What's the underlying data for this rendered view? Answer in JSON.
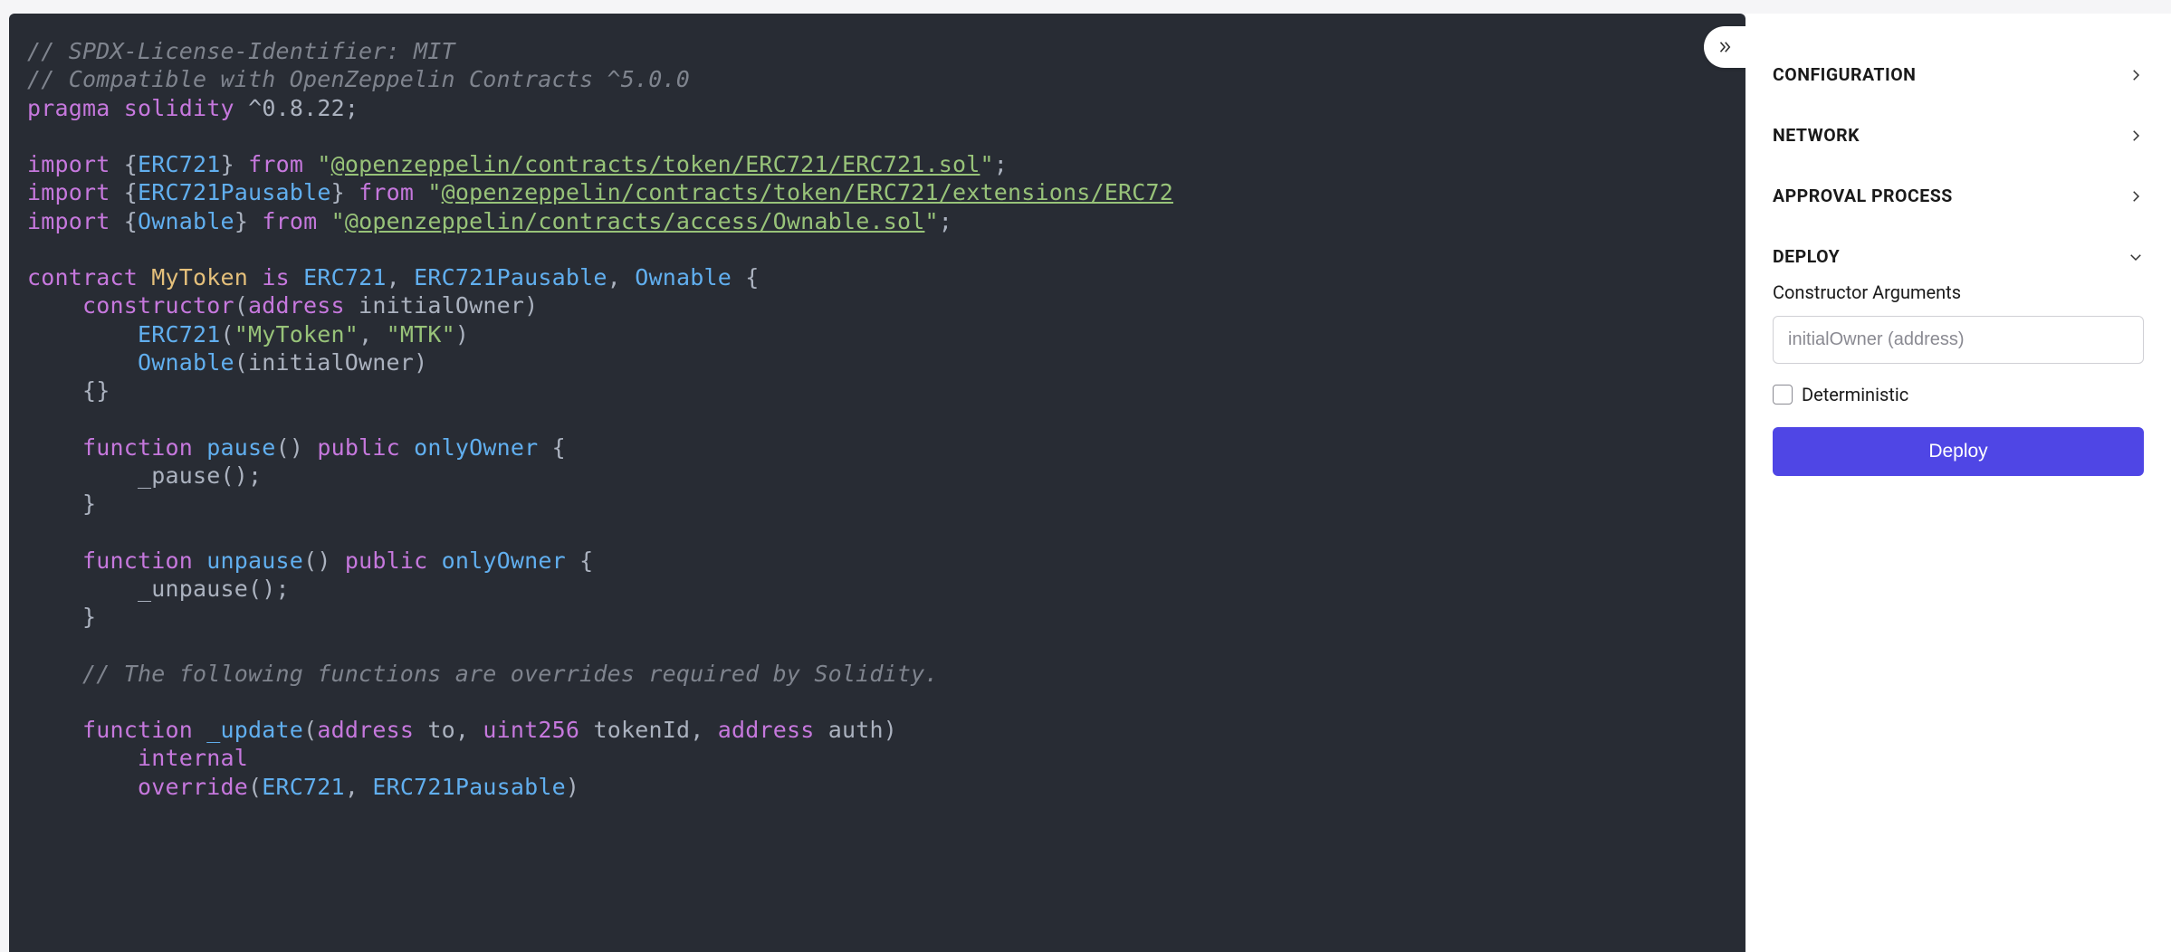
{
  "code": {
    "l1": "// SPDX-License-Identifier: MIT",
    "l2": "// Compatible with OpenZeppelin Contracts ^5.0.0",
    "pragma_kw": "pragma",
    "solidity_kw": "solidity",
    "version": "^0.8.22",
    "import_kw": "import",
    "from_kw": "from",
    "erc721": "ERC721",
    "erc721_link": "@openzeppelin/contracts/token/ERC721/ERC721.sol",
    "erc721pausable": "ERC721Pausable",
    "erc721pausable_link": "@openzeppelin/contracts/token/ERC721/extensions/ERC72",
    "ownable": "Ownable",
    "ownable_link": "@openzeppelin/contracts/access/Ownable.sol",
    "contract_kw": "contract",
    "is_kw": "is",
    "contract_name": "MyToken",
    "constructor_kw": "constructor",
    "address_kw": "address",
    "uint256_kw": "uint256",
    "initialOwner": "initialOwner",
    "mytoken_str": "\"MyToken\"",
    "mtk_str": "\"MTK\"",
    "function_kw": "function",
    "public_kw": "public",
    "internal_kw": "internal",
    "override_kw": "override",
    "onlyOwner": "onlyOwner",
    "pause_fn": "pause",
    "_pause": "_pause",
    "unpause_fn": "unpause",
    "_unpause": "_unpause",
    "_update": "_update",
    "to": "to",
    "tokenId": "tokenId",
    "auth": "auth",
    "override_comment": "// The following functions are overrides required by Solidity."
  },
  "sidebar": {
    "configuration": "CONFIGURATION",
    "network": "NETWORK",
    "approval": "APPROVAL PROCESS",
    "deploy": "DEPLOY",
    "constructor_args": "Constructor Arguments",
    "initialOwner_placeholder": "initialOwner (address)",
    "deterministic": "Deterministic",
    "deploy_btn": "Deploy"
  }
}
